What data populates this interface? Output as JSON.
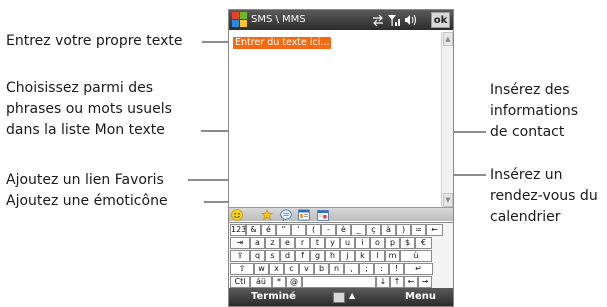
{
  "callouts": {
    "own_text": "Entrez votre propre texte",
    "phrases_l1": "Choisissez parmi des",
    "phrases_l2": "phrases ou mots usuels",
    "phrases_l3": "dans la liste Mon texte",
    "favorites": "Ajoutez un lien Favoris",
    "emoticon": "Ajoutez une émoticône",
    "contact_l1": "Insérez des",
    "contact_l2": "informations",
    "contact_l3": "de contact",
    "appointment_l1": "Insérez un",
    "appointment_l2": "rendez-vous du",
    "appointment_l3": "calendrier"
  },
  "phone": {
    "title": "SMS \\ MMS",
    "ok": "ok",
    "status_icons": [
      "sync-icon",
      "signal-icon",
      "volume-icon"
    ],
    "placeholder": "Entrer du texte ici...",
    "toolbar_icons": [
      "emoticon-icon",
      "favorites-icon",
      "my-text-icon",
      "contact-icon",
      "calendar-icon"
    ],
    "soft_left": "Terminé",
    "soft_right": "Menu",
    "input_panel_icon": "keyboard-icon"
  },
  "keyboard": {
    "rows": [
      [
        "123",
        "&",
        "é",
        "\"",
        "'",
        "(",
        "-",
        "è",
        "_",
        "ç",
        "à",
        ")",
        "=",
        "←"
      ],
      [
        "⇥",
        "a",
        "z",
        "e",
        "r",
        "t",
        "y",
        "u",
        "i",
        "o",
        "p",
        "$",
        "€"
      ],
      [
        "⇪",
        "q",
        "s",
        "d",
        "f",
        "g",
        "h",
        "j",
        "k",
        "l",
        "m",
        "ù"
      ],
      [
        "⇧",
        "w",
        "x",
        "c",
        "v",
        "b",
        "n",
        ",",
        ";",
        ":",
        "!",
        "↵"
      ],
      [
        "Ctl",
        "áü",
        "*",
        "@",
        "",
        "↓",
        "↑",
        "←",
        "→"
      ]
    ]
  },
  "colors": {
    "highlight": "#f26b12",
    "titlebar": "#3a3a3a"
  }
}
